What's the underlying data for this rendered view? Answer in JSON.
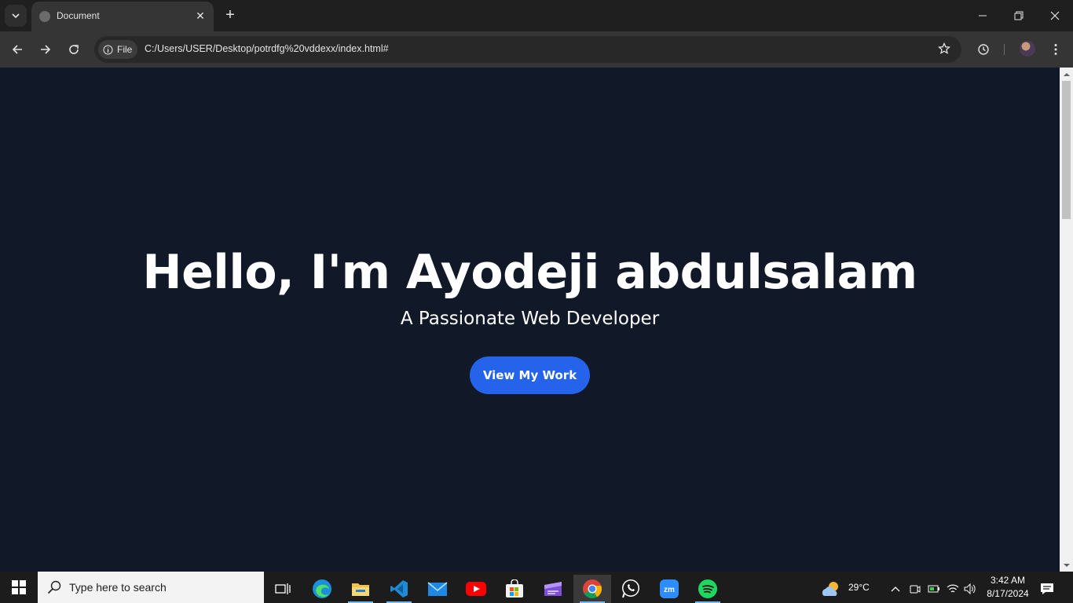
{
  "browser": {
    "tab_title": "Document",
    "site_chip": "File",
    "url": "C:/Users/USER/Desktop/potrdfg%20vddexx/index.html#"
  },
  "page": {
    "hero_title": "Hello, I'm Ayodeji abdulsalam",
    "hero_subtitle": "A Passionate Web Developer",
    "cta_label": "View My Work",
    "background_color": "#111827",
    "accent_color": "#2563eb"
  },
  "taskbar": {
    "search_placeholder": "Type here to search",
    "apps": [
      "task-view",
      "edge",
      "file-explorer",
      "vscode",
      "mail",
      "youtube",
      "microsoft-store",
      "clipchamp",
      "chrome",
      "whatsapp",
      "zoom",
      "spotify"
    ],
    "weather": "29°C",
    "time": "3:42 AM",
    "date": "8/17/2024"
  }
}
